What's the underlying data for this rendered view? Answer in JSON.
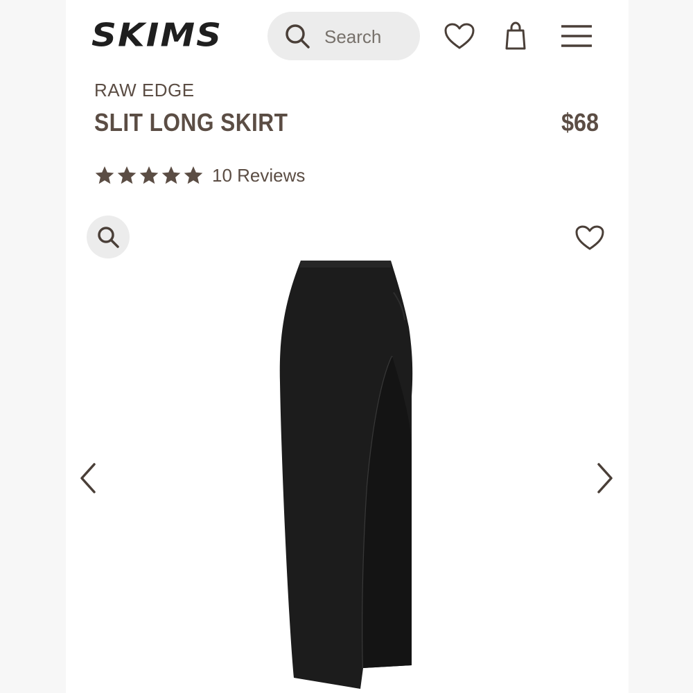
{
  "header": {
    "logo": "SKIMS",
    "search_placeholder": "Search",
    "icons": [
      "search-icon",
      "heart-icon",
      "shopping-bag-icon",
      "menu-icon"
    ]
  },
  "product": {
    "collection": "RAW EDGE",
    "name": "SLIT LONG SKIRT",
    "price": "$68",
    "rating": 5,
    "reviews_label": "10 Reviews",
    "image_colour": "black"
  },
  "gallery": {
    "icons": [
      "zoom-icon",
      "heart-icon",
      "chevron-left-icon",
      "chevron-right-icon"
    ]
  },
  "colors": {
    "brand_text": "#5b4d44",
    "logo": "#1f1f1f",
    "search_bg": "#ececec",
    "product": "#1c1c1c"
  }
}
